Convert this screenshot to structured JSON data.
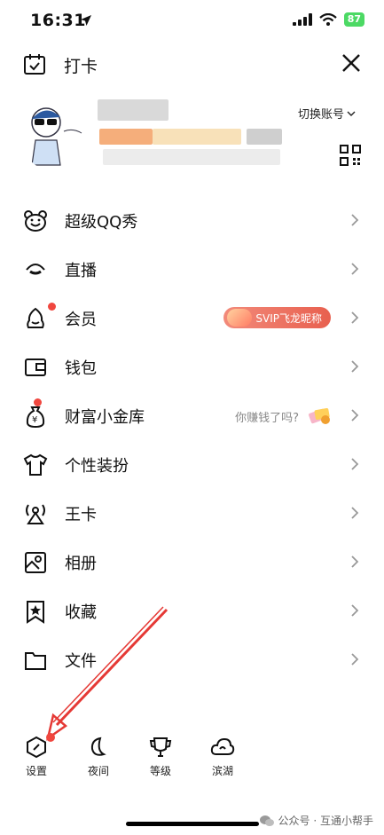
{
  "status_bar": {
    "time": "16:31",
    "battery": "87"
  },
  "header": {
    "checkin_label": "打卡"
  },
  "profile": {
    "switch_account": "切换账号"
  },
  "menu": [
    {
      "label": "超级QQ秀",
      "icon": "bear-icon"
    },
    {
      "label": "直播",
      "icon": "live-icon"
    },
    {
      "label": "会员",
      "icon": "vip-icon",
      "badge": "SVIP飞龙昵称"
    },
    {
      "label": "钱包",
      "icon": "wallet-icon"
    },
    {
      "label": "财富小金库",
      "icon": "money-bag-icon",
      "tip": "你赚钱了吗?"
    },
    {
      "label": "个性装扮",
      "icon": "tshirt-icon"
    },
    {
      "label": "王卡",
      "icon": "signal-tower-icon"
    },
    {
      "label": "相册",
      "icon": "photo-album-icon"
    },
    {
      "label": "收藏",
      "icon": "bookmark-star-icon"
    },
    {
      "label": "文件",
      "icon": "folder-icon"
    }
  ],
  "bottom_bar": [
    {
      "label": "设置",
      "icon": "settings-hexagon-icon"
    },
    {
      "label": "夜间",
      "icon": "moon-icon"
    },
    {
      "label": "等级",
      "icon": "crown-cup-icon"
    },
    {
      "label": "滨湖",
      "icon": "cloud-weather-icon"
    }
  ],
  "watermark": "公众号 · 互通小帮手",
  "colors": {
    "red_dot": "#f0473f",
    "annotation_arrow": "#e53935",
    "battery": "#4cd964"
  }
}
